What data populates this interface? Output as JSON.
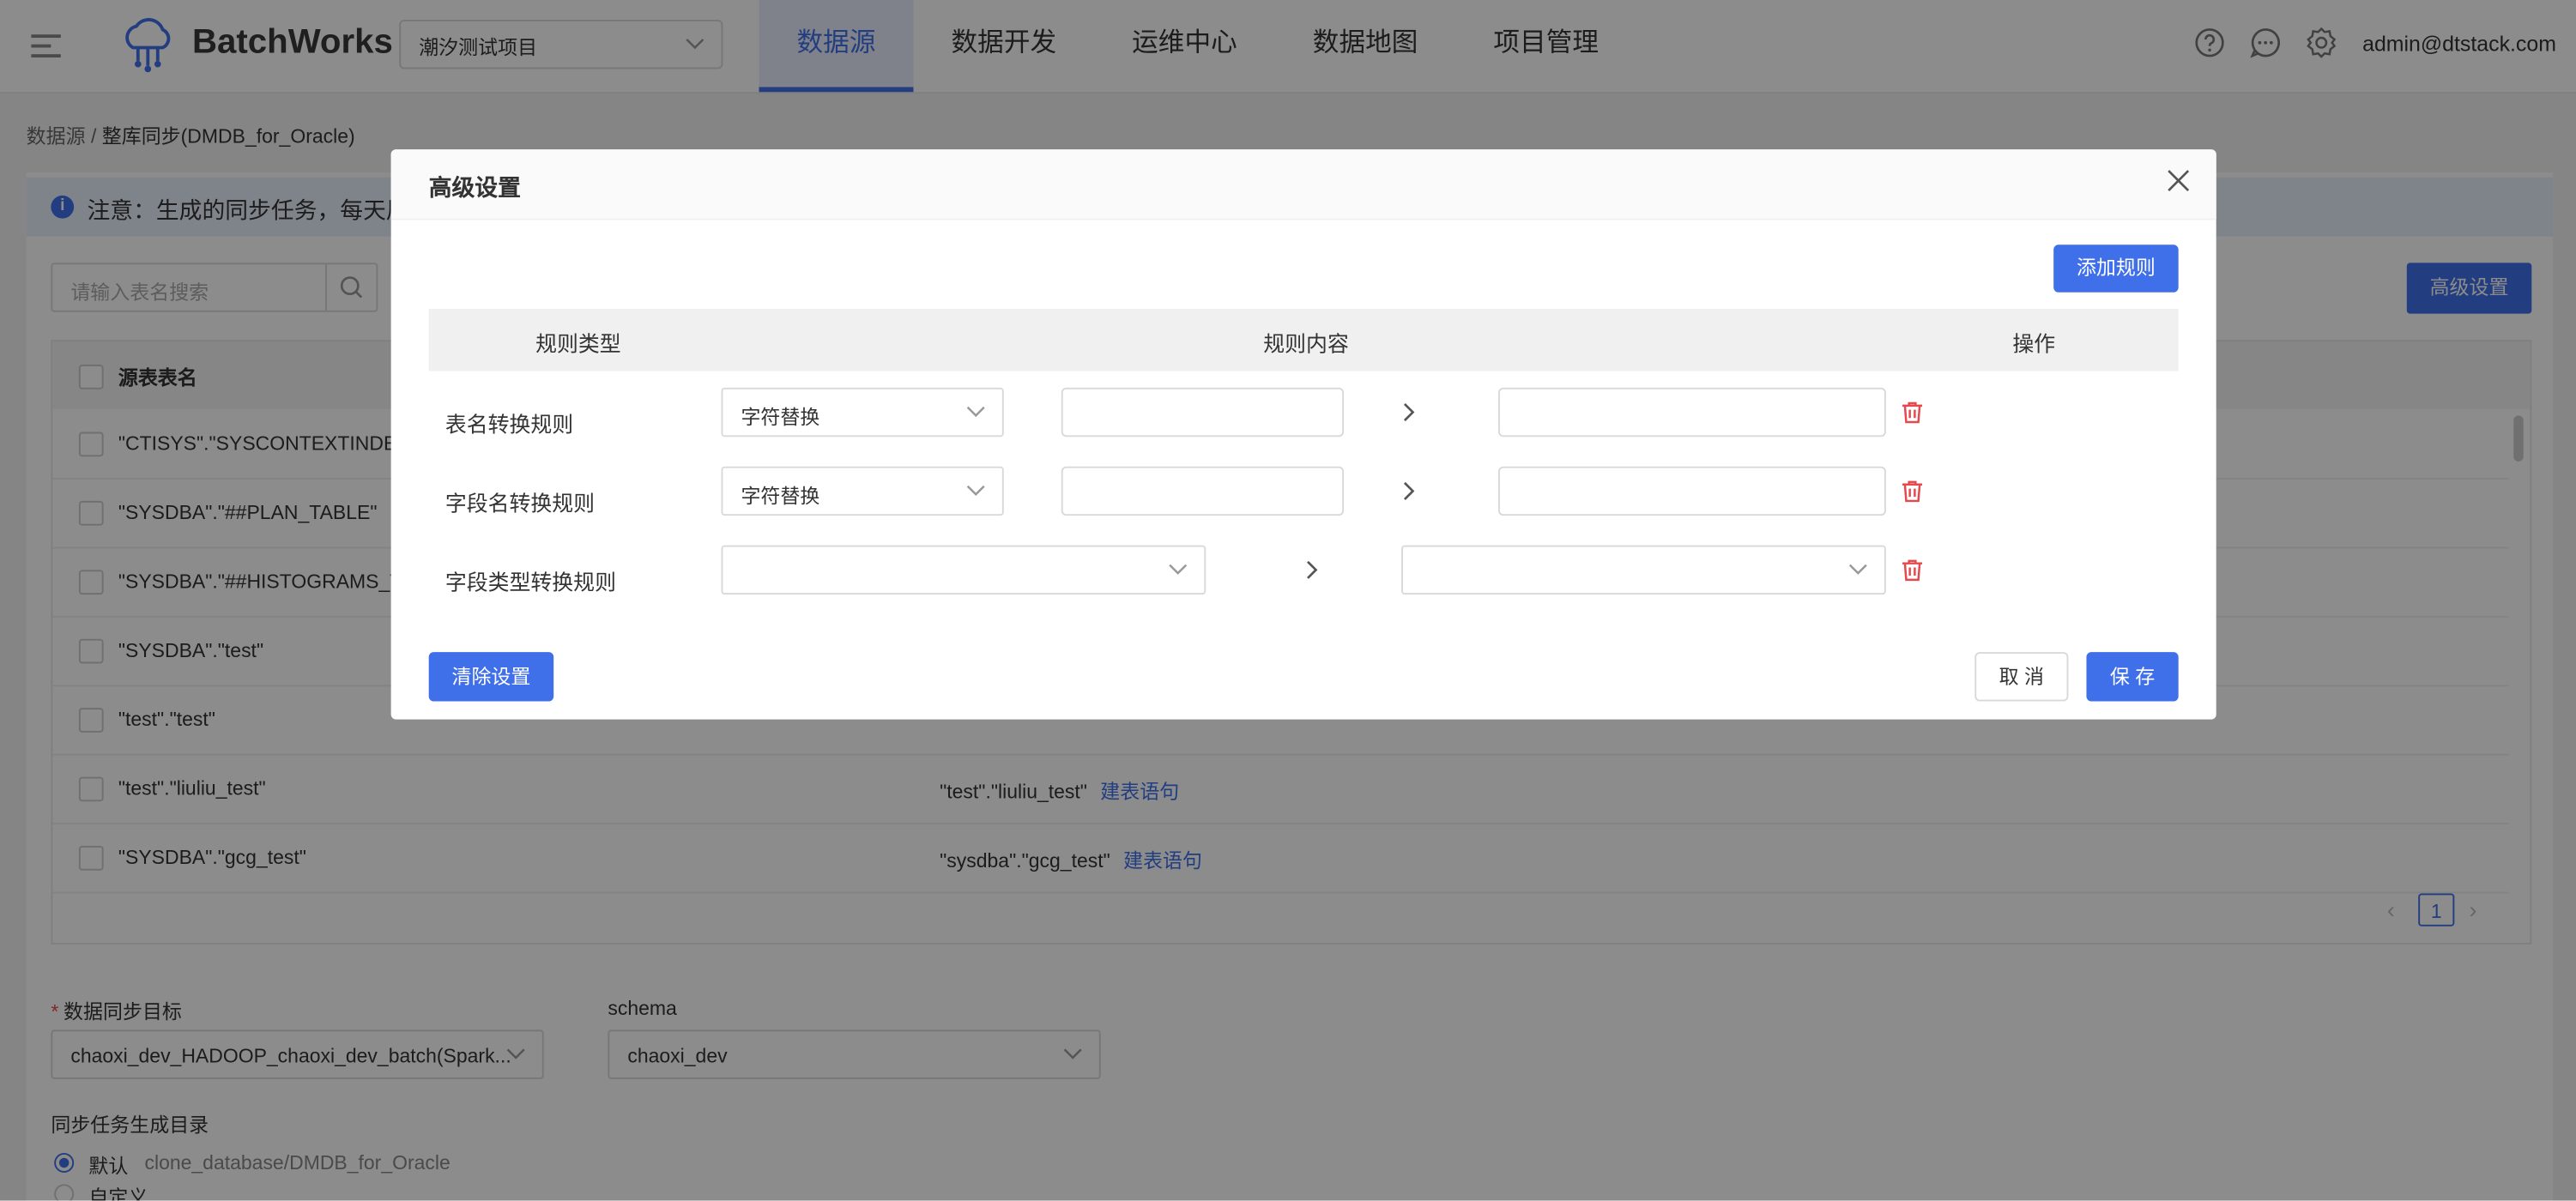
{
  "header": {
    "app_name": "BatchWorks",
    "project": "潮汐测试项目",
    "nav": [
      "数据源",
      "数据开发",
      "运维中心",
      "数据地图",
      "项目管理"
    ],
    "active_nav": 0,
    "user": "admin@dtstack.com"
  },
  "breadcrumb": {
    "parent": "数据源",
    "sep": " / ",
    "current": "整库同步(DMDB_for_Oracle)"
  },
  "notice": {
    "text": "注意：生成的同步任务，每天周"
  },
  "toolbar": {
    "search_placeholder": "请输入表名搜索",
    "advanced_label": "高级设置"
  },
  "table": {
    "header_source": "源表表名",
    "rows": [
      {
        "source": "\"CTISYS\".\"SYSCONTEXTINDEX",
        "target": "",
        "link": ""
      },
      {
        "source": "\"SYSDBA\".\"##PLAN_TABLE\"",
        "target": "",
        "link": ""
      },
      {
        "source": "\"SYSDBA\".\"##HISTOGRAMS_TA",
        "target": "",
        "link": ""
      },
      {
        "source": "\"SYSDBA\".\"test\"",
        "target": "",
        "link": ""
      },
      {
        "source": "\"test\".\"test\"",
        "target": "",
        "link": ""
      },
      {
        "source": "\"test\".\"liuliu_test\"",
        "target": "\"test\".\"liuliu_test\"",
        "link": "建表语句"
      },
      {
        "source": "\"SYSDBA\".\"gcg_test\"",
        "target": "\"sysdba\".\"gcg_test\"",
        "link": "建表语句"
      }
    ],
    "page": "1"
  },
  "form": {
    "target_label": "数据同步目标",
    "target_value": "chaoxi_dev_HADOOP_chaoxi_dev_batch(Spark...",
    "schema_label": "schema",
    "schema_value": "chaoxi_dev",
    "dir_label": "同步任务生成目录",
    "default_label": "默认",
    "default_path": "clone_database/DMDB_for_Oracle",
    "custom_label": "自定义"
  },
  "modal": {
    "title": "高级设置",
    "add_rule": "添加规则",
    "col_type": "规则类型",
    "col_content": "规则内容",
    "col_action": "操作",
    "rules": [
      {
        "label": "表名转换规则",
        "mode": "字符替换"
      },
      {
        "label": "字段名转换规则",
        "mode": "字符替换"
      },
      {
        "label": "字段类型转换规则",
        "mode": ""
      }
    ],
    "clear": "清除设置",
    "cancel": "取 消",
    "save": "保 存"
  },
  "colors": {
    "primary": "#3f6fe9",
    "danger": "#e5484d"
  },
  "icons": [
    "menu-icon",
    "cloud-logo-icon",
    "help-icon",
    "message-icon",
    "gear-icon",
    "info-icon",
    "search-icon",
    "close-icon",
    "chevron-down-icon",
    "chevron-right-icon",
    "trash-icon"
  ]
}
